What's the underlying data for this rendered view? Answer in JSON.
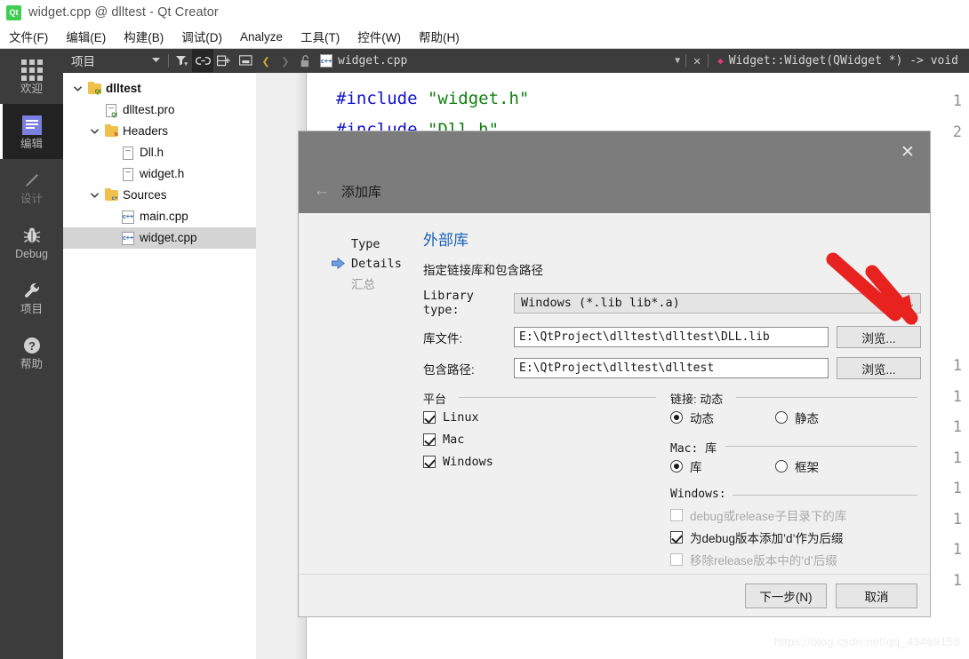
{
  "window": {
    "title": "widget.cpp @ dlltest - Qt Creator",
    "logo_icon": "qt-logo-icon"
  },
  "menubar": {
    "items": [
      {
        "label": "文件(F)"
      },
      {
        "label": "编辑(E)"
      },
      {
        "label": "构建(B)"
      },
      {
        "label": "调试(D)"
      },
      {
        "label": "Analyze"
      },
      {
        "label": "工具(T)"
      },
      {
        "label": "控件(W)"
      },
      {
        "label": "帮助(H)"
      }
    ]
  },
  "modebar": {
    "items": [
      {
        "label": "欢迎",
        "icon": "grid-icon",
        "state": "normal"
      },
      {
        "label": "编辑",
        "icon": "edit-lines-icon",
        "state": "active"
      },
      {
        "label": "设计",
        "icon": "pencil-icon",
        "state": "disabled"
      },
      {
        "label": "Debug",
        "icon": "bug-icon",
        "state": "normal"
      },
      {
        "label": "项目",
        "icon": "wrench-icon",
        "state": "normal"
      },
      {
        "label": "帮助",
        "icon": "question-mark-icon",
        "state": "normal"
      }
    ]
  },
  "sidepanel": {
    "title": "项目",
    "toolbar": [
      {
        "name": "view-selector-caret",
        "icon": "chevron-down-icon",
        "active": false
      },
      {
        "name": "filter-button",
        "icon": "filter-icon",
        "active": false
      },
      {
        "name": "link-with-editor-button",
        "icon": "link-icon",
        "active": true
      },
      {
        "name": "split-button",
        "icon": "split-icon",
        "active": false
      },
      {
        "name": "close-panel-button",
        "icon": "minimize-icon",
        "active": false
      }
    ],
    "tree": [
      {
        "label": "dlltest",
        "indent": 0,
        "twisty": "v",
        "icon": "qt-project-folder-icon",
        "bold": true,
        "selected": false
      },
      {
        "label": "dlltest.pro",
        "indent": 1,
        "twisty": "",
        "icon": "pro-file-icon",
        "bold": false,
        "selected": false
      },
      {
        "label": "Headers",
        "indent": 1,
        "twisty": "v",
        "icon": "headers-folder-icon",
        "bold": false,
        "selected": false
      },
      {
        "label": "Dll.h",
        "indent": 2,
        "twisty": "",
        "icon": "header-file-icon",
        "bold": false,
        "selected": false
      },
      {
        "label": "widget.h",
        "indent": 2,
        "twisty": "",
        "icon": "header-file-icon",
        "bold": false,
        "selected": false
      },
      {
        "label": "Sources",
        "indent": 1,
        "twisty": "v",
        "icon": "sources-folder-icon",
        "bold": false,
        "selected": false
      },
      {
        "label": "main.cpp",
        "indent": 2,
        "twisty": "",
        "icon": "cpp-file-icon",
        "bold": false,
        "selected": false
      },
      {
        "label": "widget.cpp",
        "indent": 2,
        "twisty": "",
        "icon": "cpp-file-icon",
        "bold": false,
        "selected": true
      }
    ]
  },
  "editor": {
    "toolbar": {
      "back_icon": "chevron-left-icon",
      "forward_icon": "chevron-right-icon",
      "lock_icon": "unlocked-icon",
      "file_icon": "cpp-file-icon",
      "filename": "widget.cpp",
      "dropdown_icon": "chevron-down-icon",
      "close_icon": "close-icon",
      "symbol_icon": "method-diamond-icon",
      "symbol": "Widget::Widget(QWidget *) -> void"
    },
    "lines": [
      {
        "num": "1",
        "segments": [
          {
            "text": "#include ",
            "cls": "kw"
          },
          {
            "text": "\"widget.h\"",
            "cls": "str"
          }
        ]
      },
      {
        "num": "2",
        "segments": [
          {
            "text": "#include ",
            "cls": "kw"
          },
          {
            "text": "\"Dll.h\"",
            "cls": "str"
          }
        ]
      }
    ],
    "hidden_line_numbers": [
      "1",
      "1",
      "1",
      "1",
      "1",
      "1",
      "1",
      "1"
    ]
  },
  "dialog": {
    "title": "添加库",
    "back_icon": "arrow-left-icon",
    "close_icon": "close-icon",
    "steps": [
      {
        "label": "Type",
        "current": false,
        "muted": false
      },
      {
        "label": "Details",
        "current": true,
        "muted": false
      },
      {
        "label": "汇总",
        "current": false,
        "muted": true
      }
    ],
    "form": {
      "heading": "外部库",
      "subheading": "指定链接库和包含路径",
      "library_type": {
        "label": "Library type:",
        "value": "Windows (*.lib lib*.a)",
        "caret_icon": "chevron-down-icon"
      },
      "lib_file": {
        "label": "库文件:",
        "value": "E:\\QtProject\\dlltest\\dlltest\\DLL.lib",
        "browse_label": "浏览..."
      },
      "include_path": {
        "label": "包含路径:",
        "value": "E:\\QtProject\\dlltest\\dlltest",
        "browse_label": "浏览..."
      },
      "platform_group": {
        "title": "平台",
        "items": [
          {
            "label": "Linux",
            "checked": true,
            "disabled": false
          },
          {
            "label": "Mac",
            "checked": true,
            "disabled": false
          },
          {
            "label": "Windows",
            "checked": true,
            "disabled": false
          }
        ]
      },
      "link_group": {
        "title": "链接: 动态",
        "options": [
          {
            "label": "动态",
            "selected": true
          },
          {
            "label": "静态",
            "selected": false
          }
        ]
      },
      "mac_group": {
        "title": "Mac: 库",
        "options": [
          {
            "label": "库",
            "selected": true
          },
          {
            "label": "框架",
            "selected": false
          }
        ]
      },
      "windows_group": {
        "title": "Windows:",
        "items": [
          {
            "label": "debug或release子目录下的库",
            "checked": false,
            "disabled": true
          },
          {
            "label": "为debug版本添加’d’作为后缀",
            "checked": true,
            "disabled": false
          },
          {
            "label": "移除release版本中的’d’后缀",
            "checked": false,
            "disabled": true
          }
        ]
      }
    },
    "footer": {
      "next_label": "下一步(N)",
      "cancel_label": "取消"
    }
  },
  "annotation": {
    "arrow_color": "#e8231f",
    "points_at": "lib-file-browse-button"
  },
  "watermark": "https://blog.csdn.net/qq_43469158"
}
